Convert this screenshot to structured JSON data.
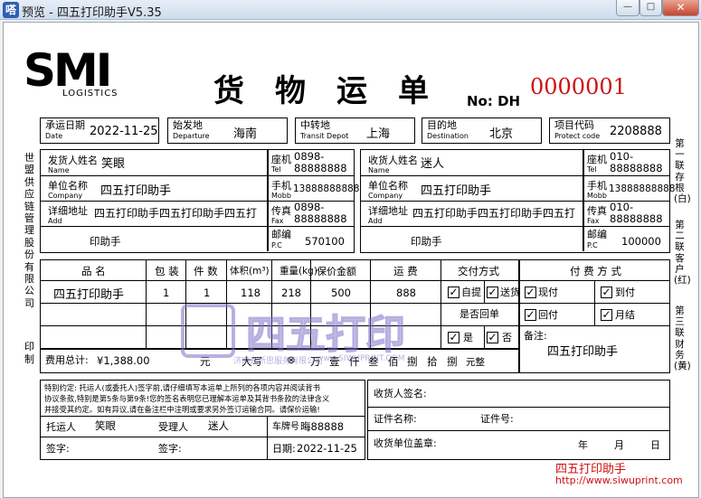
{
  "window": {
    "title": "预览 - 四五打印助手V5.35",
    "icon_char": "嗒",
    "min": "—",
    "max": "□",
    "close": "✕"
  },
  "logo": {
    "mark": "SMI",
    "sub": "LOGISTICS"
  },
  "doc": {
    "title": "货物运单",
    "no_label": "No: DH",
    "no_value": "0000001"
  },
  "row1": {
    "date_label": "承运日期",
    "date_sub": "Date",
    "date": "2022-11-25",
    "dep_label": "始发地",
    "dep_sub": "Departure",
    "dep": "海南",
    "transit_label": "中转地",
    "transit_sub": "Transit Depot",
    "transit": "上海",
    "dest_label": "目的地",
    "dest_sub": "Destination",
    "dest": "北京",
    "proj_label": "项目代码",
    "proj_sub": "Protect code",
    "proj": "2208888"
  },
  "sender": {
    "name_label": "发货人姓名",
    "name_sub": "Name",
    "name": "笑眼",
    "tel_label": "座机",
    "tel_sub": "Tel",
    "tel": "0898-88888888",
    "company_label": "单位名称",
    "company_sub": "Company",
    "company": "四五打印助手",
    "mobile_label": "手机",
    "mobile_sub": "Mobb",
    "mobile": "13888888888",
    "addr_label": "详细地址",
    "addr_sub": "Add",
    "addr1": "四五打印助手四五打印助手四五打",
    "addr2": "印助手",
    "fax_label": "传真",
    "fax_sub": "Fax",
    "fax": "0898-88888888",
    "pc_label": "邮编",
    "pc_sub": "P.C",
    "pc": "570100"
  },
  "receiver": {
    "name_label": "收货人姓名",
    "name_sub": "Name",
    "name": "迷人",
    "tel_label": "座机",
    "tel_sub": "Tel",
    "tel": "010-88888888",
    "company_label": "单位名称",
    "company_sub": "Company",
    "company": "四五打印助手",
    "mobile_label": "手机",
    "mobile_sub": "Mobb",
    "mobile": "13888888888",
    "addr_label": "详细地址",
    "addr_sub": "Add",
    "addr1": "四五打印助手四五打印助手四五打",
    "addr2": "印助手",
    "fax_label": "传真",
    "fax_sub": "Fax",
    "fax": "010-88888888",
    "pc_label": "邮编",
    "pc_sub": "P.C",
    "pc": "100000"
  },
  "left_vertical": "世盟供应链管理股份有限公司",
  "print_vertical": "印制",
  "right_vertical": {
    "c1": "第一联存根(白)",
    "c2": "第二联客户(红)",
    "c3": "第三联财务(黄)"
  },
  "goods": {
    "headers": [
      "品 名",
      "包 装",
      "件 数",
      "体积(m³)",
      "重量(kg)",
      "保价金额",
      "运 费",
      "交付方式",
      "付 费 方 式"
    ],
    "row": [
      "四五打印助手",
      "1",
      "1",
      "118",
      "218",
      "500",
      "888"
    ],
    "pickup": "自提",
    "delivery": "送货",
    "cash": "现付",
    "on_arrival": "到付",
    "return_label": "是否回单",
    "return_pay": "回付",
    "monthly": "月结",
    "yes": "是",
    "no": "否",
    "check": "✓",
    "remark_label": "备注:",
    "remark": "四五打印助手"
  },
  "total": {
    "label": "费用总计:",
    "value": "¥1,388.00",
    "yuan": "元",
    "daxie": "大写",
    "d1": "⊗",
    "d2": "万",
    "d3": "壹",
    "d4": "仟",
    "d5": "叁",
    "d6": "佰",
    "d7": "捌",
    "d8": "拾",
    "d9": "捌",
    "end": "元整"
  },
  "terms": {
    "text1": "特别约定: 托运人(或委托人)签字前,请仔细填写本运单上所列的各项内容并阅读背书",
    "text2": "协议条款,特别是第5条与第9条!您的签名表明您已理解本运单及其背书条款的法律含义",
    "text3": "并接受其约定。如有异议,请在备注栏中注明或要求另外签订运输合同。请保价运输!"
  },
  "sign": {
    "shipper_label": "托运人",
    "shipper": "笑眼",
    "handler_label": "受理人",
    "handler": "迷人",
    "plate_label": "车牌号",
    "plate": "晦88888",
    "sig1": "签字:",
    "sig2": "签字:",
    "date_label": "日期:",
    "date": "2022-11-25"
  },
  "receipt": {
    "signer": "收货人签名:",
    "idname": "证件名称:",
    "idno": "证件号:",
    "stamp": "收货单位盖章:",
    "year": "年",
    "month": "月",
    "day": "日"
  },
  "watermark": {
    "brand": "四五打印",
    "url": "www.SIWUPRINT.COM",
    "owner": "济南开所思服务有限公司"
  },
  "footer": {
    "brand": "四五打印助手",
    "url": "http://www.siwuprint.com"
  },
  "colors": {
    "number_red": "#cc1111",
    "footer_red": "#d01010",
    "watermark": "#7d6fc9"
  }
}
